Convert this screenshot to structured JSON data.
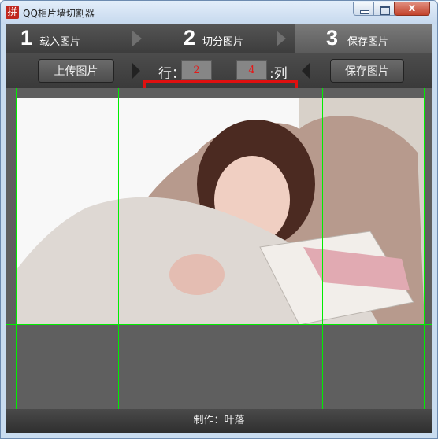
{
  "window": {
    "title": "QQ相片墙切割器",
    "icon_glyph": "拼",
    "controls": {
      "minimize": "─",
      "maximize": "□",
      "close": "x"
    }
  },
  "steps": [
    {
      "number": "1",
      "label": "载入图片"
    },
    {
      "number": "2",
      "label": "切分图片"
    },
    {
      "number": "3",
      "label": "保存图片"
    }
  ],
  "toolbar": {
    "upload_label": "上传图片",
    "row_label": "行：",
    "rows_value": "2",
    "cols_value": "4",
    "col_label": ":列",
    "save_label": "保存图片"
  },
  "canvas": {
    "grid_rows": 2,
    "grid_cols": 4,
    "line_color": "#00ee00",
    "background_color": "#5f5f5f"
  },
  "footer": {
    "credit": "制作：叶落"
  }
}
